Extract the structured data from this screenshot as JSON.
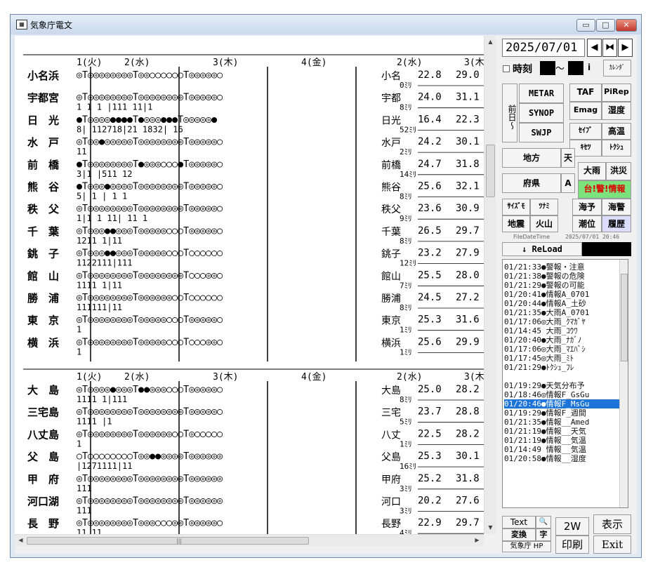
{
  "window": {
    "title": "気象庁電文",
    "min": "▭",
    "max": "□",
    "close": "✕"
  },
  "board": {
    "day_headers": [
      "1(火)",
      "2(水)",
      "3(木)",
      "4(金)",
      "2(水)",
      "3(木"
    ],
    "blocks": [
      {
        "stations": [
          {
            "name": "小名浜",
            "short": "小名",
            "sym": "◎T◎◎◎◎◎◎◎◎T◎◎○○○○○○T◎◎◎◎◎○",
            "cnt": "",
            "rain": "0ﾐﾘ",
            "tmin": "22.8",
            "tmax": "29.0"
          },
          {
            "name": "宇都宮",
            "short": "宇都",
            "sym": "◎T◎◎◎◎◎◎◎◎T◎◎◎◎◎◎◎◎T◎◎◎◎◎○",
            "cnt": " 1  1  1 |111   11|1",
            "rain": "8ﾐﾘ",
            "tmin": "24.0",
            "tmax": "31.1"
          },
          {
            "name": "日　光",
            "short": "日光",
            "sym": "●T◎◎◎◎●●●●T●◎◎◎●●●T◎◎◎◎◎●",
            "cnt": "8| 112718|21  1832|    16",
            "rain": "52ﾐﾘ",
            "tmin": "16.4",
            "tmax": "22.3"
          },
          {
            "name": "水　戸",
            "short": "水戸",
            "sym": "◎T◎◎●◎◎◎◎◎T◎◎◎◎◎◎◎◎T◎◎◎◎◎○",
            "cnt": " 11",
            "rain": "2ﾐﾘ",
            "tmin": "24.2",
            "tmax": "30.1"
          },
          {
            "name": "前　橋",
            "short": "前橋",
            "sym": "●T◎◎◎◎◎◎◎◎T●◎◎◎○○○●T◎◎◎◎◎○",
            "cnt": "3|1  |511   12",
            "rain": "14ﾐﾘ",
            "tmin": "24.7",
            "tmax": "31.8"
          },
          {
            "name": "熊　谷",
            "short": "熊谷",
            "sym": "●T◎◎◎●◎◎◎◎T◎◎◎◎◎◎◎◎T◎◎◎◎◎○",
            "cnt": "5| 1   | 1  1",
            "rain": "8ﾐﾘ",
            "tmin": "25.6",
            "tmax": "32.1"
          },
          {
            "name": "秩　父",
            "short": "秩父",
            "sym": "◎T◎◎◎◎◎◎◎◎T◎◎◎◎◎◎◎◎T◎◎◎◎◎○",
            "cnt": "1|1  1 11|  11    1",
            "rain": "9ﾐﾘ",
            "tmin": "23.6",
            "tmax": "30.9"
          },
          {
            "name": "千　葉",
            "short": "千葉",
            "sym": "◎T◎◎◎●●◎◎◎T◎◎◎◎◎○○○T◎◎◎◎◎○",
            "cnt": " 1211  1|11",
            "rain": "8ﾐﾘ",
            "tmin": "26.5",
            "tmax": "29.7"
          },
          {
            "name": "銚　子",
            "short": "銚子",
            "sym": "◎T◎◎◎●●◎◎◎T◎◎◎◎◎○○○T○○○○○○",
            "cnt": " 1122111|111",
            "rain": "12ﾐﾘ",
            "tmin": "23.2",
            "tmax": "27.9"
          },
          {
            "name": "館　山",
            "short": "館山",
            "sym": "◎T◎◎◎◎◎◎◎◎T◎◎◎◎◎◎◎◎T○○○◎◎○",
            "cnt": " 1111  1|11",
            "rain": "7ﾐﾘ",
            "tmin": "25.5",
            "tmax": "28.0"
          },
          {
            "name": "勝　浦",
            "short": "勝浦",
            "sym": "◎T◎◎◎◎◎◎◎◎T◎◎◎◎◎◎○○T○○○○○○",
            "cnt": " 111111|11",
            "rain": "8ﾐﾘ",
            "tmin": "24.5",
            "tmax": "27.2"
          },
          {
            "name": "東　京",
            "short": "東京",
            "sym": "◎T◎◎◎◎◎◎◎◎T◎◎◎◎◎○○○T◎◎◎◎◎○",
            "cnt": " 1",
            "rain": "1ﾐﾘ",
            "tmin": "25.3",
            "tmax": "31.6"
          },
          {
            "name": "横　浜",
            "short": "横浜",
            "sym": "◎T◎◎◎◎◎◎◎◎T◎◎◎◎◎○○○T○○○◎◎○",
            "cnt": "    1",
            "rain": "1ﾐﾘ",
            "tmin": "25.6",
            "tmax": "29.9"
          }
        ]
      },
      {
        "stations": [
          {
            "name": "大　島",
            "short": "大島",
            "sym": "◎T◎◎◎◎●◎◎◎T●●◎◎◎○○○T◎◎◎◎◎○",
            "cnt": " 1111  1|111",
            "rain": "8ﾐﾘ",
            "tmin": "25.0",
            "tmax": "28.2"
          },
          {
            "name": "三宅島",
            "short": "三宅",
            "sym": "◎T◎◎◎◎◎◎◎◎T◎◎◎◎◎◎◎◎T◎◎◎◎◎○",
            "cnt": "  1111   |1",
            "rain": "5ﾐﾘ",
            "tmin": "23.7",
            "tmax": "28.8"
          },
          {
            "name": "八丈島",
            "short": "八丈",
            "sym": "◎T◎◎◎◎◎◎◎◎T◎◎◎◎◎◎○○T◎○○○○○",
            "cnt": "           1",
            "rain": "1ﾐﾘ",
            "tmin": "22.5",
            "tmax": "28.2"
          },
          {
            "name": "父　島",
            "short": "父島",
            "sym": "○T○○○○○○○○T◎◎●●◎◎◎◎T◎◎◎◎◎◎",
            "cnt": "   |1271111|11",
            "rain": "16ﾐﾘ",
            "tmin": "25.3",
            "tmax": "30.1"
          },
          {
            "name": "甲　府",
            "short": "甲府",
            "sym": "◎T◎◎◎◎◎◎◎◎T◎◎◎◎◎◎◎◎T◎◎◎◎◎◎",
            "cnt": "        111",
            "rain": "3ﾐﾘ",
            "tmin": "25.2",
            "tmax": "31.8"
          },
          {
            "name": "河口湖",
            "short": "河口",
            "sym": "◎T◎◎◎◎◎◎◎◎T◎◎◎◎◎◎◎◎T◎◎◎◎◎◎",
            "cnt": "       111",
            "rain": "3ﾐﾘ",
            "tmin": "20.2",
            "tmax": "27.6"
          },
          {
            "name": "長　野",
            "short": "長野",
            "sym": "◎T◎◎◎◎◎◎◎◎T◎◎◎○○○◎◎T◎◎◎◎◎○",
            "cnt": "   11    11",
            "rain": "4ﾐﾘ",
            "tmin": "22.9",
            "tmax": "29.7"
          }
        ]
      }
    ]
  },
  "panel": {
    "date": "2025/07/01",
    "prev": "◀",
    "stop": "⧓",
    "next": "▶",
    "time_label": "時刻",
    "tilde": "〜",
    "info": "i",
    "calendar": "ｶﾚﾝﾀﾞ",
    "maebi": "前日〜",
    "metar": "METAR",
    "synop": "SYNOP",
    "swjp": "SWJP",
    "taf": "TAF",
    "pirep": "PiRep",
    "emag": "Emag",
    "shitsudo": "湿度",
    "seifu": "ｾｲﾌﾞ",
    "kouon": "高温",
    "kisetsu": "ｷｾﾂ",
    "tokushu": "ﾄｸｼｭ",
    "chiho": "地方",
    "ten": "天",
    "fuken": "府県",
    "a": "A",
    "ooame": "大雨",
    "kouzui": "洪災",
    "taikei": "台!警!情報",
    "saizumo": "ｻｲｽﾞﾓ",
    "tsunami": "ﾂﾅﾐ",
    "kaiyo": "海予",
    "kaikei": "海警",
    "jishin": "地震",
    "kazan": "火山",
    "chouiki": "潮位",
    "rireki": "履歴",
    "filedate_label": "FileDateTime",
    "filedate": "2025/07/01 20:46",
    "reload": "↓ ReLoad",
    "log": [
      "01/21:33●警報・注意",
      "01/21:38●警報の危険",
      "01/21:29●警報の可能",
      "01/20:41●情報A_0701",
      "01/20:44●情報A_土砂",
      "01/21:35●大雨A_0701",
      "01/17:06◎大雨_ｸﾏｶﾞﾔ",
      "01/14:45  大雨_ｺｳﾜ",
      "01/20:40●大雨_ﾅｶﾞﾉ",
      "01/17:06◎大雨_ﾏｴﾊﾞｼ",
      "01/17:45◎大雨_ﾐﾄ",
      "01/21:29●ﾄｸｼｭ_ﾌﾚ",
      "",
      "01/19:29●天気分布予",
      "01/18:46◎情報F_GsGu",
      "01/20:46●情報F_MsGu",
      "01/19:29●情報F_週間",
      "01/21:35●情報__Amed",
      "01/21:19●情報__天気",
      "01/21:19●情報__気温",
      "01/14:49  情報__気温",
      "01/20:58●情報__湿度"
    ],
    "selected_log": 15,
    "text_btn": "Text",
    "search_icon": "🔍",
    "henkan": "変換",
    "ji": "字",
    "jma_hp": "気象庁 HP",
    "two_w": "2W",
    "hyouji": "表示",
    "insatsu": "印刷",
    "exit": "Exit"
  }
}
